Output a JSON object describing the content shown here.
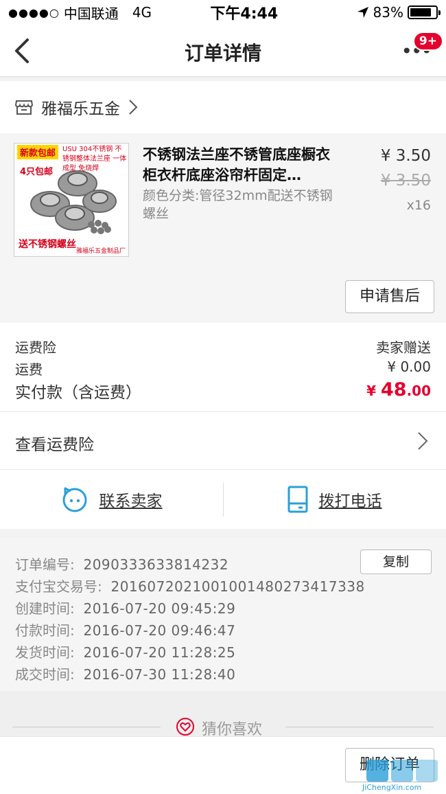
{
  "status_bar": {
    "carrier": "中国联通",
    "network": "4G",
    "time": "下午4:44",
    "battery": "83%",
    "battery_level": 0.83
  },
  "nav": {
    "title": "订单详情",
    "badge": "9+"
  },
  "shop": {
    "name": "雅福乐五金"
  },
  "item": {
    "thumb": {
      "tag_new": "新款包邮",
      "tag_pack": "4只包邮",
      "desc": "USU 304不锈钢 不锈钢整体法兰座 一体成型 免烧焊",
      "bottom": "送不锈钢螺丝",
      "maker": "雅福乐五金制品厂"
    },
    "title": "不锈钢法兰座不锈管底座橱衣柜衣杆底座浴帘杆固定…",
    "spec": "颜色分类:管径32mm配送不锈钢螺丝",
    "price": "¥ 3.50",
    "original_price": "¥ 3.50",
    "quantity": "x16",
    "after_sale_button": "申请售后"
  },
  "fees": {
    "insurance_label": "运费险",
    "insurance_value": "卖家赠送",
    "shipping_label": "运费",
    "shipping_value": "¥ 0.00",
    "total_label": "实付款（含运费）",
    "total_symbol": "¥ ",
    "total_int": "48",
    "total_dec": ".00"
  },
  "view_insurance": {
    "label": "查看运费险"
  },
  "contact": {
    "seller": "联系卖家",
    "phone": "拨打电话"
  },
  "order_info": {
    "copy_button": "复制",
    "rows": [
      {
        "k": "订单编号:",
        "v": "2090333633814232"
      },
      {
        "k": "支付宝交易号:",
        "v": "2016072021001001480273417338"
      },
      {
        "k": "创建时间:",
        "v": "2016-07-20 09:45:29"
      },
      {
        "k": "付款时间:",
        "v": "2016-07-20 09:46:47"
      },
      {
        "k": "发货时间:",
        "v": "2016-07-20 11:28:25"
      },
      {
        "k": "成交时间:",
        "v": "2016-07-30 11:28:40"
      }
    ]
  },
  "guess": {
    "label": "猜你喜欢"
  },
  "bottom": {
    "delete_button": "删除订单"
  },
  "watermark": {
    "text": "JiChengXin.com"
  },
  "colors": {
    "accent_red": "#e5002d",
    "icon_blue": "#2a9fd8"
  }
}
